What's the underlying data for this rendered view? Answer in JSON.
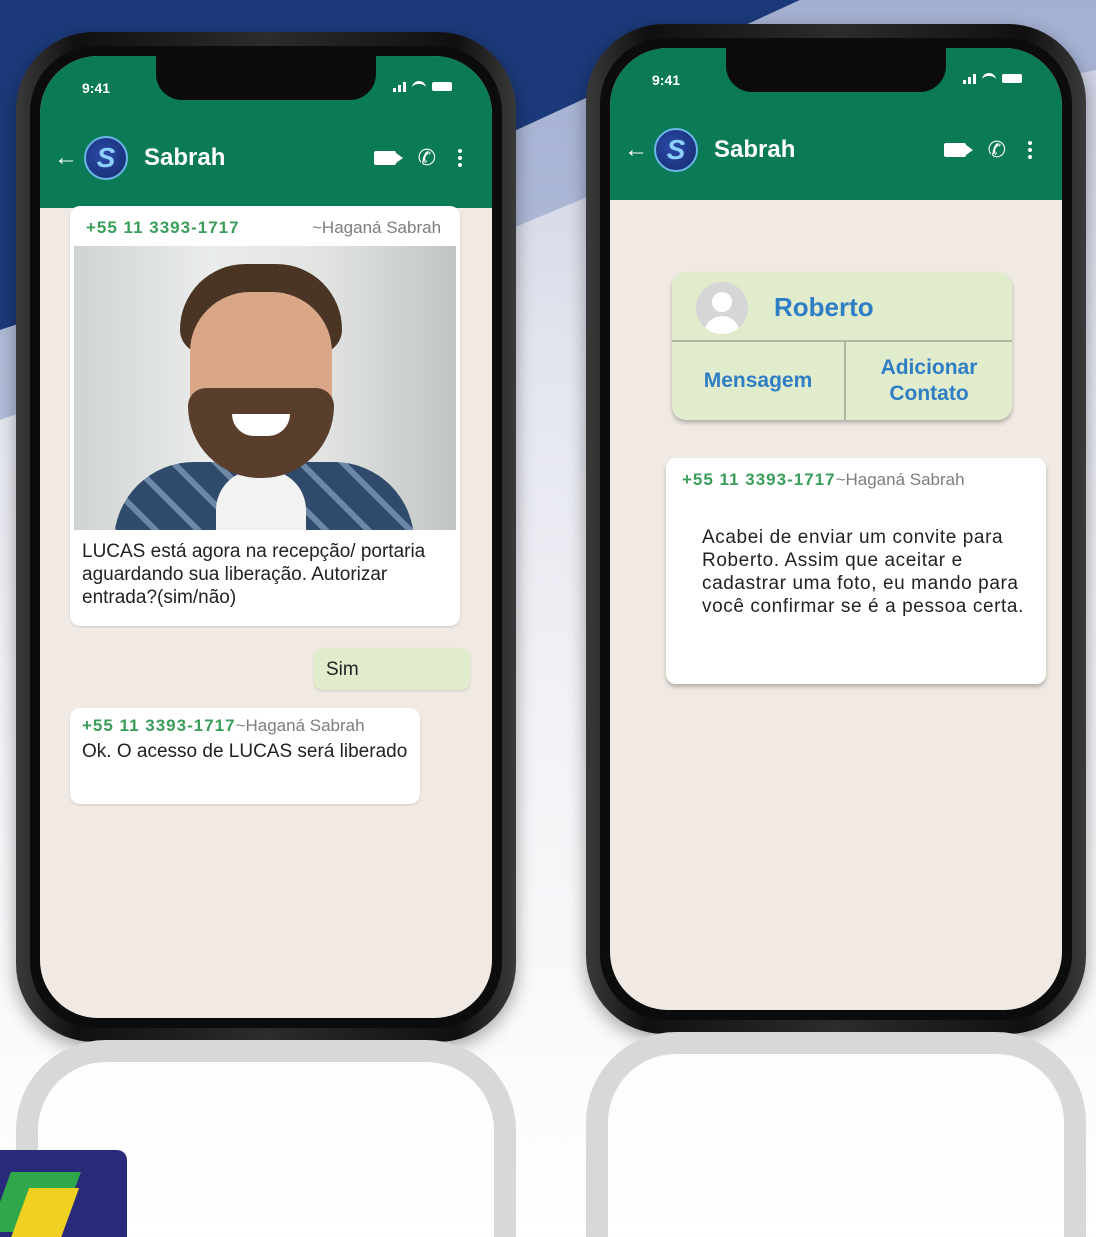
{
  "background": {
    "top_color": "#1c3a7a",
    "band_color": "#2b4f96"
  },
  "left_phone": {
    "status": {
      "time": "9:41"
    },
    "header": {
      "contact_name": "Sabrah",
      "logo_letter": "S",
      "color": "#0b7a56"
    },
    "messages": [
      {
        "sender_phone": "+55 11 3393-1717",
        "sender_name": "~Haganá Sabrah",
        "text": "LUCAS está agora na recepção/ portaria aguardando sua liberação. Autorizar entrada?(sim/não)"
      },
      {
        "sent_text": "Sim"
      },
      {
        "sender_phone": "+55 11 3393-1717",
        "sender_name": "~Haganá Sabrah",
        "text": "Ok. O acesso de LUCAS será liberado"
      }
    ]
  },
  "right_phone": {
    "status": {
      "time": "9:41"
    },
    "header": {
      "contact_name": "Sabrah",
      "logo_letter": "S"
    },
    "contact_card": {
      "name": "Roberto",
      "message_button": "Mensagem",
      "add_contact_button": "Adicionar Contato"
    },
    "message": {
      "sender_phone": "+55 11 3393-1717",
      "sender_name": "~Haganá Sabrah",
      "text": "Acabei de enviar um convite para Roberto. Assim que aceitar e cadastrar uma foto, eu mando para você confirmar se é a pessoa certa."
    }
  },
  "colors": {
    "sender_phone": "#3a9d5a",
    "link_blue": "#2f7ec4",
    "sent_bubble": "#e1eccd",
    "chat_bg": "#f1eae4"
  }
}
